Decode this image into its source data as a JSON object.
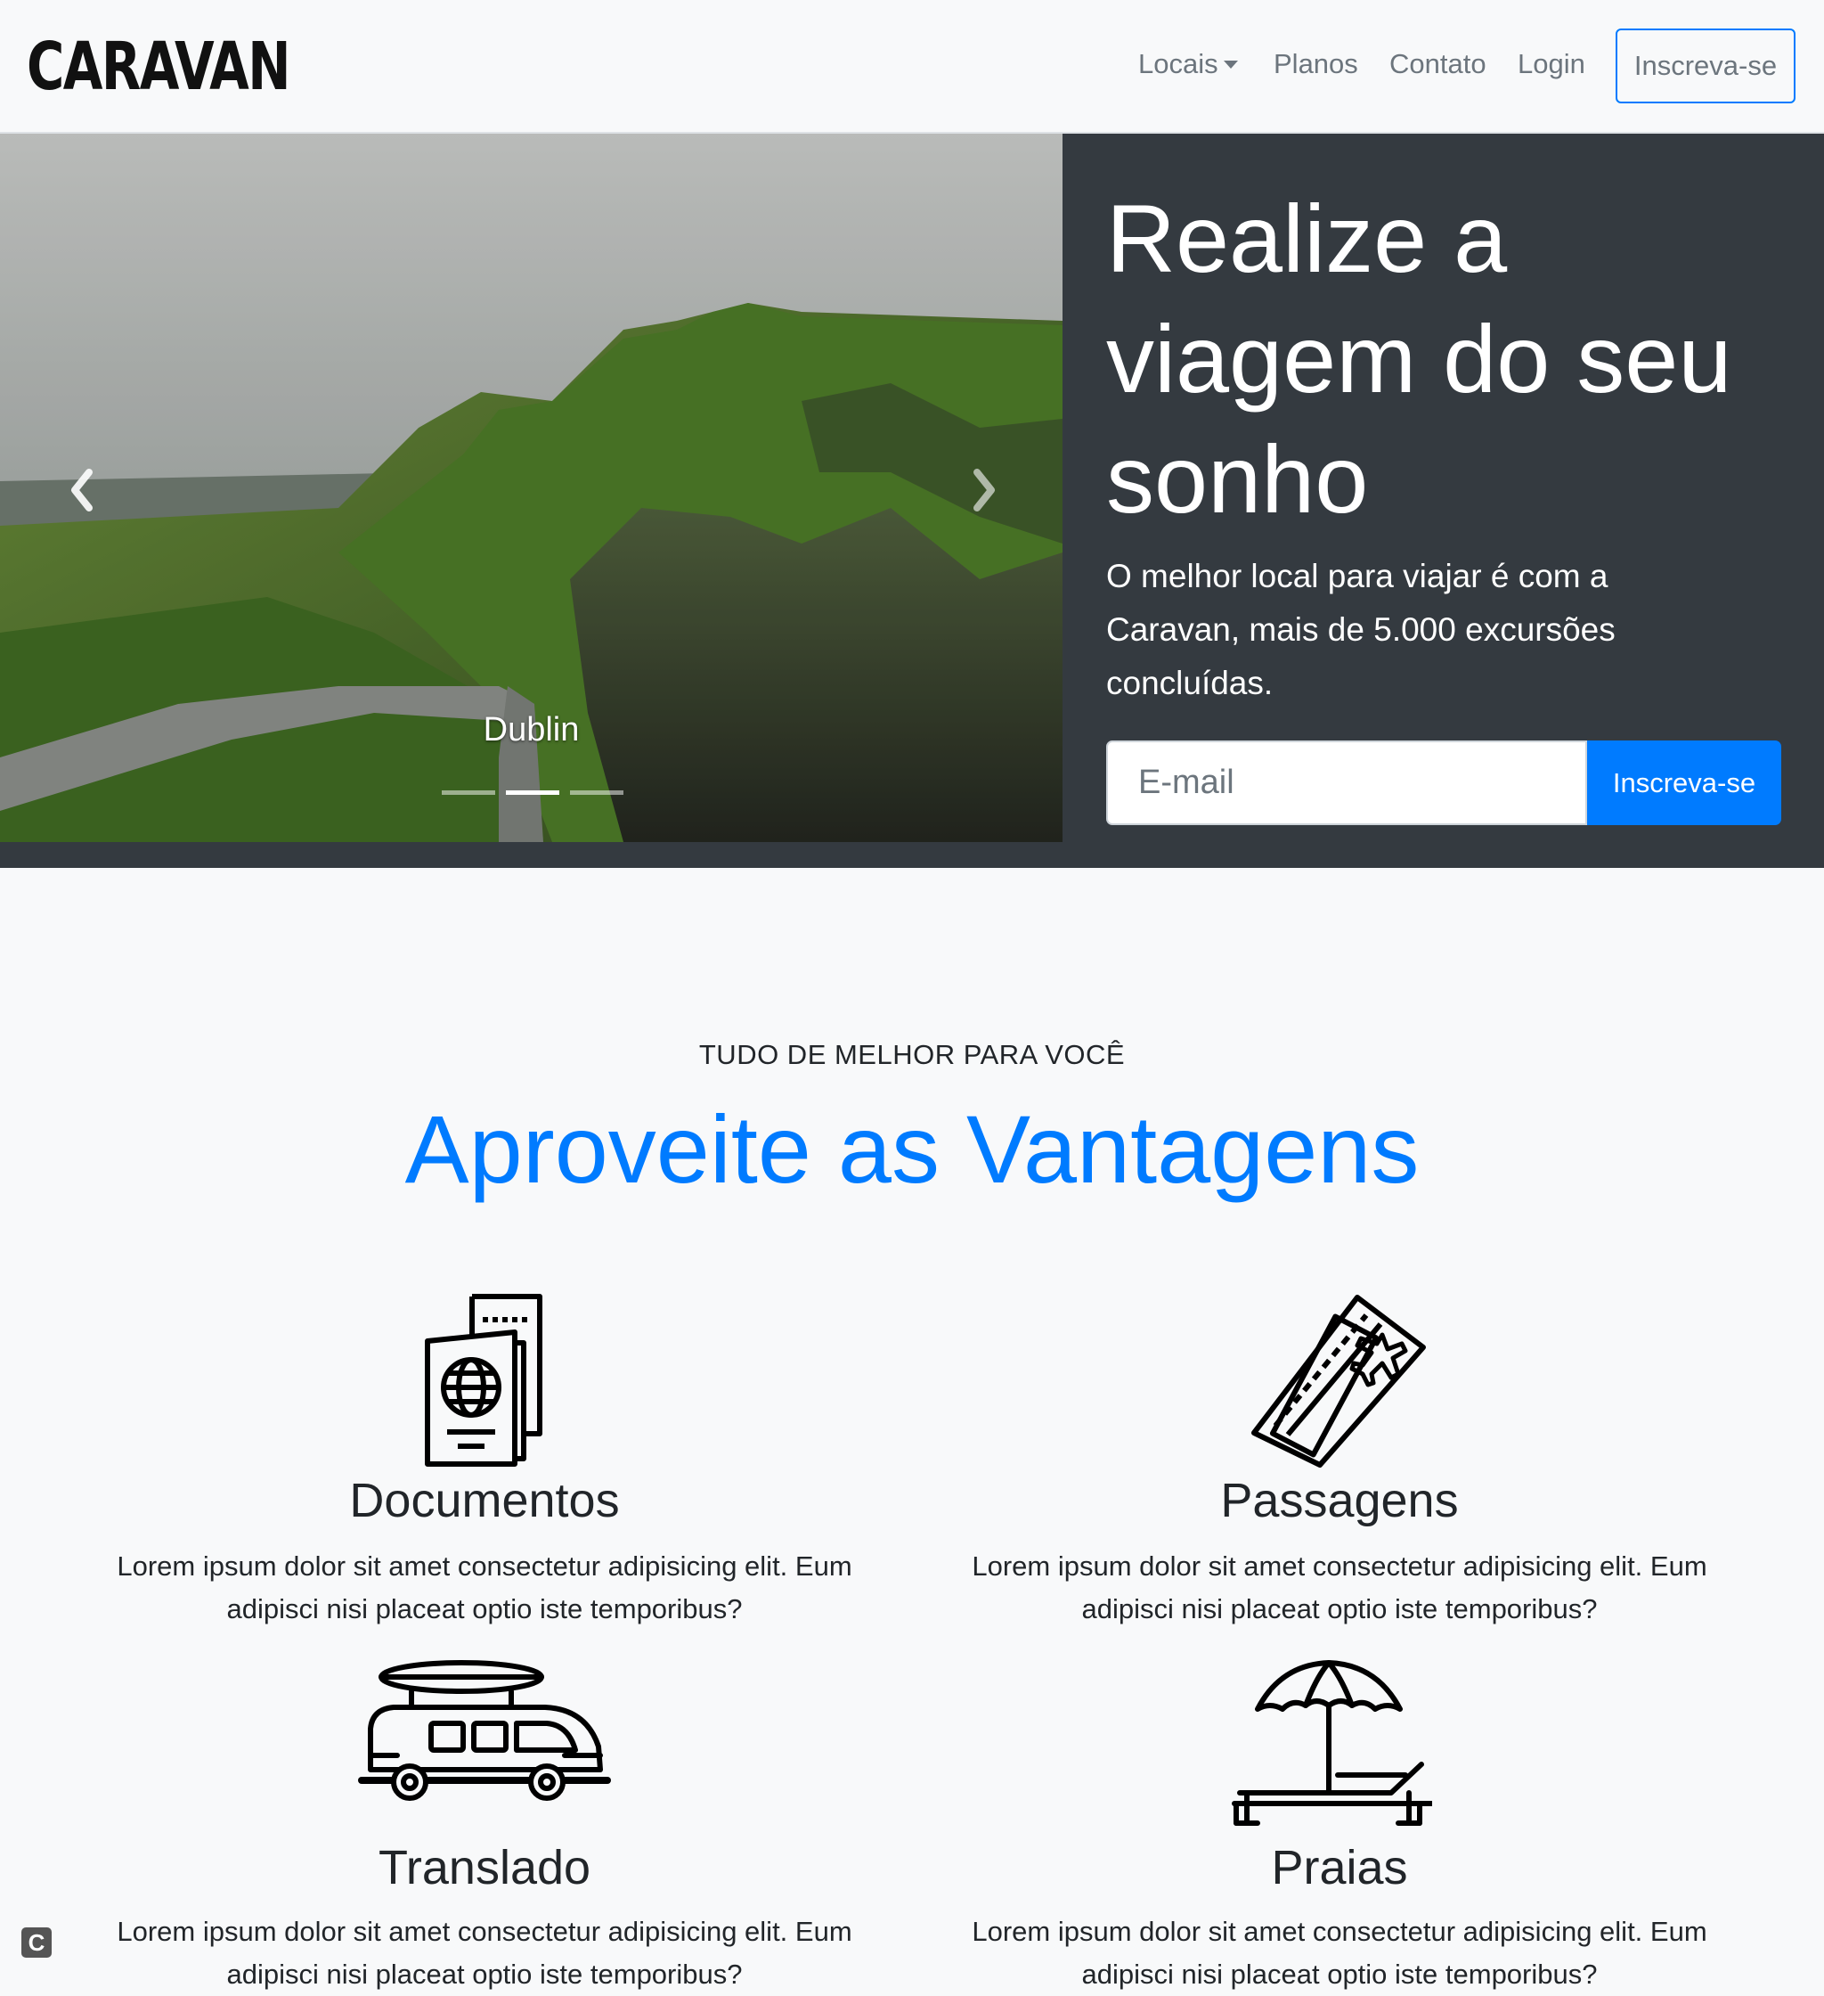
{
  "navbar": {
    "brand": "CARAVAN",
    "items": [
      "Locais",
      "Planos",
      "Contato",
      "Login"
    ],
    "cta": "Inscreva-se"
  },
  "carousel": {
    "caption": "Dublin",
    "slide_count": 3,
    "active_index": 1
  },
  "hero": {
    "title": "Realize a viagem do seu sonho",
    "text": "O melhor local para viajar é com a Caravan, mais de 5.000 excursões concluídas.",
    "email_placeholder": "E-mail",
    "button": "Inscreva-se"
  },
  "features": {
    "eyebrow": "TUDO DE MELHOR PARA VOCÊ",
    "title": "Aproveite as Vantagens",
    "items": [
      {
        "icon": "passport-icon",
        "title": "Documentos",
        "text": "Lorem ipsum dolor sit amet consectetur adipisicing elit. Eum adipisci nisi placeat optio iste temporibus?"
      },
      {
        "icon": "tickets-icon",
        "title": "Passagens",
        "text": "Lorem ipsum dolor sit amet consectetur adipisicing elit. Eum adipisci nisi placeat optio iste temporibus?"
      },
      {
        "icon": "van-icon",
        "title": "Translado",
        "text": "Lorem ipsum dolor sit amet consectetur adipisicing elit. Eum adipisci nisi placeat optio iste temporibus?"
      },
      {
        "icon": "beach-chair-icon",
        "title": "Praias",
        "text": "Lorem ipsum dolor sit amet consectetur adipisicing elit. Eum adipisci nisi placeat optio iste temporibus?"
      }
    ]
  },
  "colors": {
    "primary": "#007bff",
    "dark": "#343a40",
    "light": "#f8f9fa"
  },
  "badge": "C"
}
